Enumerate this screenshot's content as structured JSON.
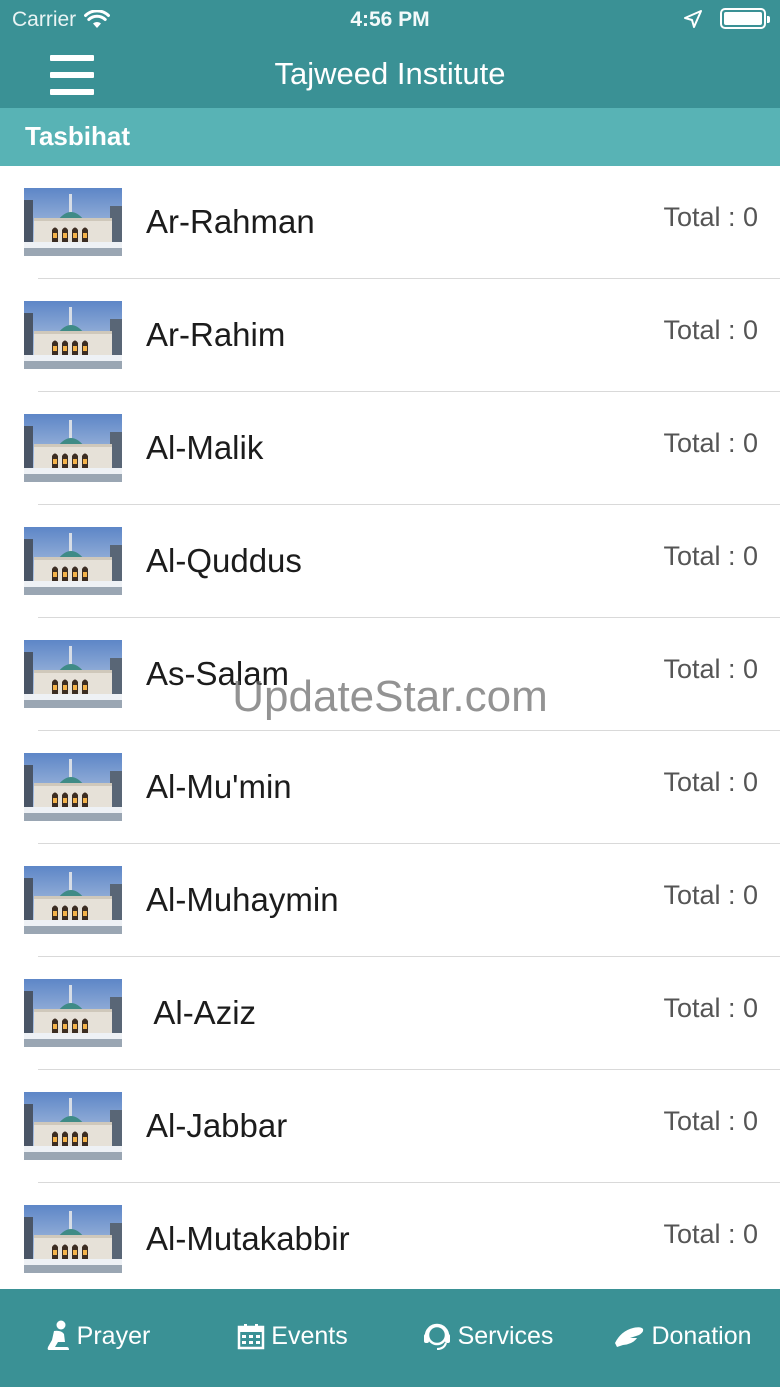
{
  "status_bar": {
    "carrier": "Carrier",
    "time": "4:56 PM",
    "icons": [
      "wifi-icon",
      "location-arrow-icon",
      "battery-icon"
    ]
  },
  "nav": {
    "title": "Tajweed Institute",
    "menu_icon": "hamburger-menu-icon"
  },
  "section": {
    "title": "Tasbihat"
  },
  "list": {
    "items": [
      {
        "name": "Ar-Rahman",
        "total": "Total : 0"
      },
      {
        "name": "Ar-Rahim",
        "total": "Total : 0"
      },
      {
        "name": "Al-Malik",
        "total": "Total : 0"
      },
      {
        "name": "Al-Quddus",
        "total": "Total : 0"
      },
      {
        "name": "As-Salam",
        "total": "Total : 0"
      },
      {
        "name": "Al-Mu'min",
        "total": "Total : 0"
      },
      {
        "name": "Al-Muhaymin",
        "total": "Total : 0"
      },
      {
        "name": " Al-Aziz",
        "total": "Total : 0"
      },
      {
        "name": "Al-Jabbar",
        "total": "Total : 0"
      },
      {
        "name": "Al-Mutakabbir",
        "total": "Total : 0"
      }
    ]
  },
  "watermark": "UpdateStar.com",
  "tabbar": {
    "tabs": [
      {
        "label": "Prayer",
        "icon": "prayer-icon"
      },
      {
        "label": "Events",
        "icon": "calendar-icon"
      },
      {
        "label": "Services",
        "icon": "headset-icon"
      },
      {
        "label": "Donation",
        "icon": "donation-icon"
      }
    ]
  },
  "colors": {
    "primary": "#3a9195",
    "section_header": "#58b3b5",
    "separator": "#d9d9d9"
  }
}
